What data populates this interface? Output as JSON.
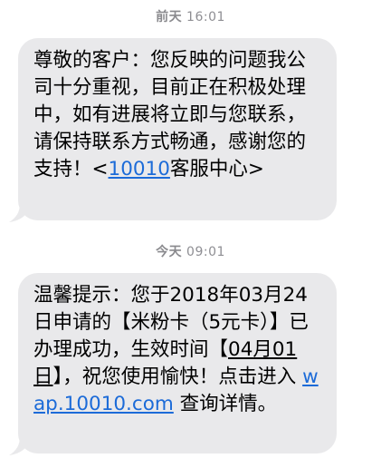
{
  "messages": [
    {
      "timestamp_day": "前天",
      "timestamp_time": "16:01",
      "text_before_link": "尊敬的客户：您反映的问题我公司十分重视，目前正在积极处理中，如有进展将立即与您联系，请保持联系方式畅通，感谢您的支持！<",
      "link_text": "10010",
      "text_after_link": "客服中心>"
    },
    {
      "timestamp_day": "今天",
      "timestamp_time": "09:01",
      "text_part1": "温馨提示：您于2018年03月24日申请的【米粉卡（5元卡）】已办理成功，生效时间【",
      "date_text": "04月01日",
      "text_part2": "】，祝您使用愉快！点击进入 ",
      "link_text": "wap.10010.com",
      "text_part3": " 查询详情。"
    }
  ],
  "colors": {
    "bubble": "#e9e9eb",
    "link": "#1c6bd8",
    "timestamp": "#8e8e93"
  }
}
